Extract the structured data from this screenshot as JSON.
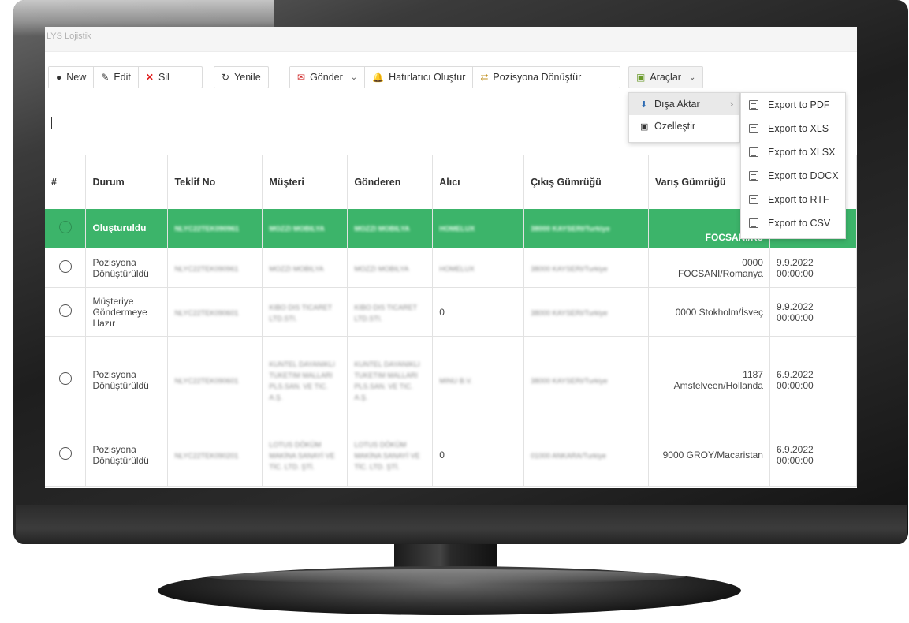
{
  "app": {
    "title": "LYS Lojistik"
  },
  "toolbar": {
    "new_label": "New",
    "edit_label": "Edit",
    "delete_label": "Sil",
    "refresh_label": "Yenile",
    "send_label": "Gönder",
    "reminder_label": "Hatırlatıcı Oluştur",
    "convert_label": "Pozisyona Dönüştür",
    "tools_label": "Araçlar"
  },
  "tools_menu": {
    "items": [
      {
        "label": "Dışa Aktar",
        "icon": "download-icon"
      },
      {
        "label": "Özelleştir",
        "icon": "customize-icon"
      }
    ]
  },
  "export_menu": {
    "items": [
      "Export to PDF",
      "Export to XLS",
      "Export to XLSX",
      "Export to DOCX",
      "Export to RTF",
      "Export to CSV"
    ]
  },
  "table": {
    "headers": [
      "#",
      "Durum",
      "Teklif No",
      "Müşteri",
      "Gönderen",
      "Alıcı",
      "Çıkış Gümrüğü",
      "Varış Gümrüğü"
    ],
    "rows": [
      {
        "durum": "Oluşturuldu",
        "teklif": "NLYC22TEK090961",
        "musteri": "MOZZI MOBILYA",
        "gonderen": "MOZZI MOBILYA",
        "alici": "HOMELUX",
        "cikis": "38000 KAYSERI/Turkiye",
        "varis": "FOCSANI/Ro",
        "tarih": "",
        "selected": true
      },
      {
        "durum": "Pozisyona Dönüştürüldü",
        "teklif": "NLYC22TEK090961",
        "musteri": "MOZZI MOBILYA",
        "gonderen": "MOZZI MOBILYA",
        "alici": "HOMELUX",
        "cikis": "38000 KAYSERI/Turkiye",
        "varis": "0000 FOCSANI/Romanya",
        "tarih": "9.9.2022 00:00:00",
        "selected": false
      },
      {
        "durum": "Müşteriye Göndermeye Hazır",
        "teklif": "NLYC22TEK090601",
        "musteri": "KIBO DIS TICARET LTD.STI.",
        "gonderen": "KIBO DIS TICARET LTD.STI.",
        "alici": "0",
        "cikis": "38000 KAYSERI/Turkiye",
        "varis": "0000 Stokholm/İsveç",
        "tarih": "9.9.2022 00:00:00",
        "selected": false
      },
      {
        "durum": "Pozisyona Dönüştürüldü",
        "teklif": "NLYC22TEK090601",
        "musteri": "KUNTEL DAYANIKLI TUKETIM MALLARI PLS.SAN. VE TIC. A.Ş.",
        "gonderen": "KUNTEL DAYANIKLI TUKETIM MALLARI PLS.SAN. VE TIC. A.Ş.",
        "alici": "MINU B.V.",
        "cikis": "38000 KAYSERI/Turkiye",
        "varis": "1187 Amstelveen/Hollanda",
        "tarih": "6.9.2022 00:00:00",
        "selected": false
      },
      {
        "durum": "Pozisyona Dönüştürüldü",
        "teklif": "NLYC22TEK090201",
        "musteri": "LOTUS DÖKÜM MAKİNA SANAYİ VE TİC. LTD. ŞTİ.",
        "gonderen": "LOTUS DÖKÜM MAKİNA SANAYİ VE TİC. LTD. ŞTİ.",
        "alici": "0",
        "cikis": "01000 ANKARA/Turkiye",
        "varis": "9000 GROY/Macaristan",
        "tarih": "6.9.2022 00:00:00",
        "selected": false
      }
    ]
  }
}
